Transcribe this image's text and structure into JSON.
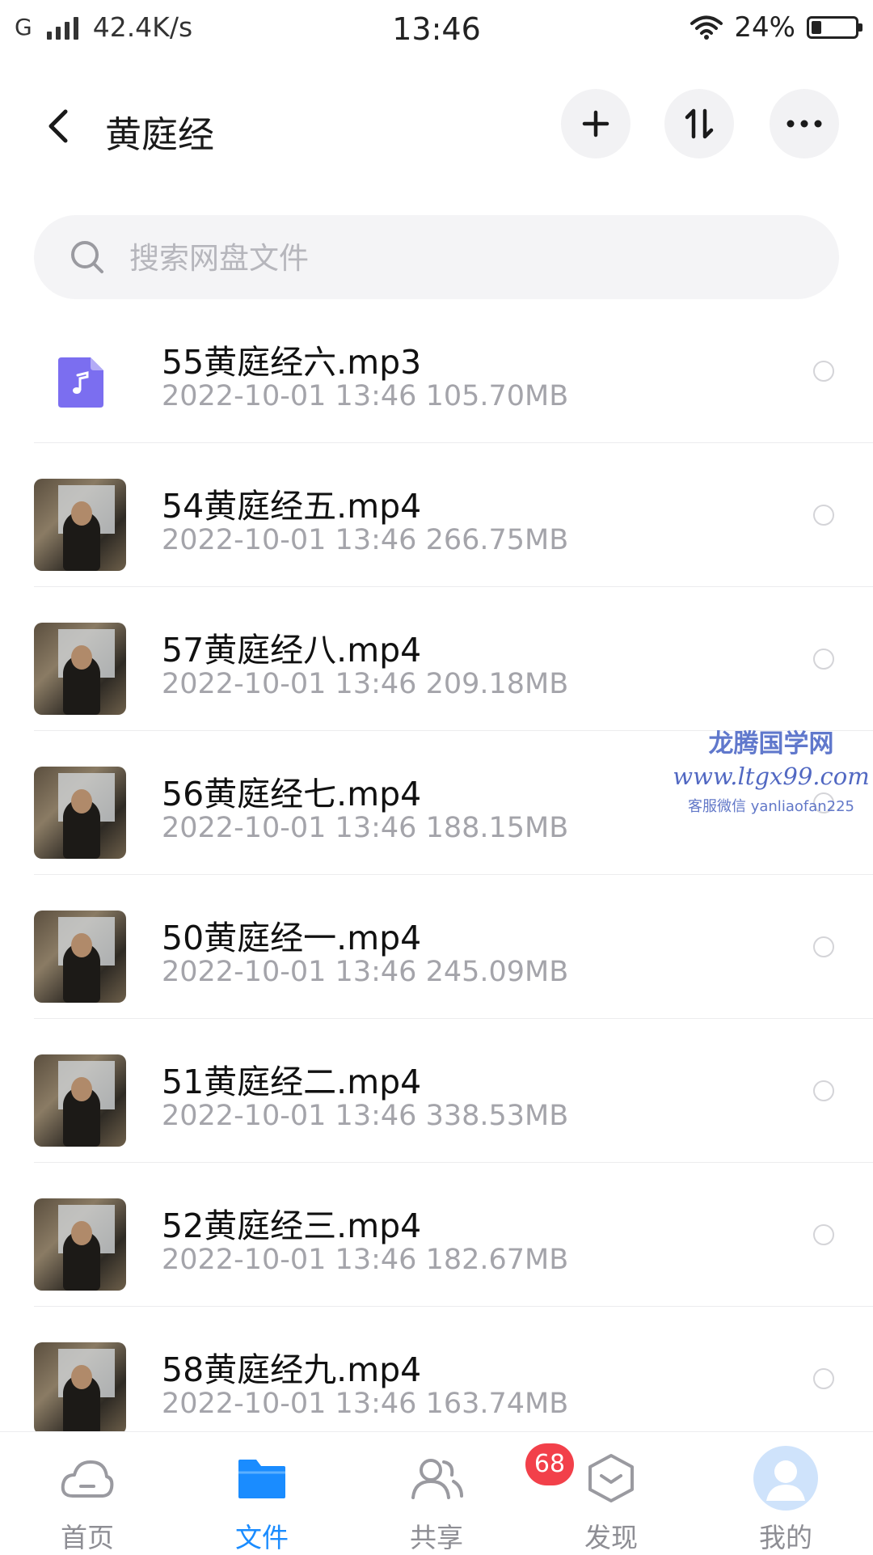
{
  "status_bar": {
    "network_type": "G",
    "speed": "42.4K/s",
    "time": "13:46",
    "battery": "24%",
    "battery_level": 0.24
  },
  "header": {
    "title": "黄庭经",
    "actions": [
      "plus-icon",
      "sort-icon",
      "more-icon"
    ]
  },
  "search": {
    "placeholder": "搜索网盘文件"
  },
  "files": [
    {
      "name": "55黄庭经六.mp3",
      "date": "2022-10-01",
      "time": "13:46",
      "size": "105.70MB",
      "type": "audio"
    },
    {
      "name": "54黄庭经五.mp4",
      "date": "2022-10-01",
      "time": "13:46",
      "size": "266.75MB",
      "type": "video"
    },
    {
      "name": "57黄庭经八.mp4",
      "date": "2022-10-01",
      "time": "13:46",
      "size": "209.18MB",
      "type": "video"
    },
    {
      "name": "56黄庭经七.mp4",
      "date": "2022-10-01",
      "time": "13:46",
      "size": "188.15MB",
      "type": "video"
    },
    {
      "name": "50黄庭经一.mp4",
      "date": "2022-10-01",
      "time": "13:46",
      "size": "245.09MB",
      "type": "video"
    },
    {
      "name": "51黄庭经二.mp4",
      "date": "2022-10-01",
      "time": "13:46",
      "size": "338.53MB",
      "type": "video"
    },
    {
      "name": "52黄庭经三.mp4",
      "date": "2022-10-01",
      "time": "13:46",
      "size": "182.67MB",
      "type": "video"
    },
    {
      "name": "58黄庭经九.mp4",
      "date": "2022-10-01",
      "time": "13:46",
      "size": "163.74MB",
      "type": "video"
    }
  ],
  "watermark": {
    "title": "龙腾国学网",
    "url": "www.ltgx99.com",
    "wechat": "客服微信 yanliaofan225"
  },
  "bottom_nav": {
    "items": [
      {
        "label": "首页",
        "icon": "cloud-icon",
        "active": false
      },
      {
        "label": "文件",
        "icon": "folder-icon",
        "active": true
      },
      {
        "label": "共享",
        "icon": "people-icon",
        "active": false,
        "badge": "68"
      },
      {
        "label": "发现",
        "icon": "discover-icon",
        "active": false
      },
      {
        "label": "我的",
        "icon": "avatar-icon",
        "active": false
      }
    ]
  },
  "colors": {
    "accent": "#1a8cff",
    "badge": "#f2404a",
    "audio_icon": "#7b6ef0",
    "meta_text": "#a4a4aa"
  }
}
